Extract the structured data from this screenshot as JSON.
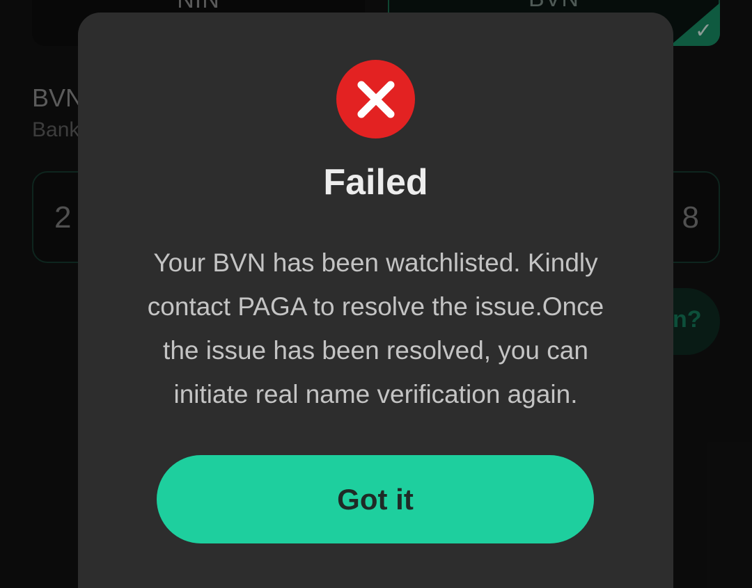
{
  "background": {
    "tabs": [
      {
        "label": "NIN",
        "selected": false
      },
      {
        "label": "BVN",
        "selected": true
      }
    ],
    "field": {
      "title": "BVN",
      "subtitle": "Bank",
      "value_start": "2",
      "value_end": "8"
    },
    "help_text": "n?"
  },
  "dialog": {
    "icon": "error-x-icon",
    "title": "Failed",
    "message": "Your BVN has been watchlisted. Kindly contact PAGA to resolve the issue.Once the issue has been resolved, you can initiate real name verification again.",
    "primary_button": "Got it"
  },
  "colors": {
    "accent": "#1ecf9e",
    "error": "#e32222",
    "dialog_bg": "#2d2d2d"
  }
}
